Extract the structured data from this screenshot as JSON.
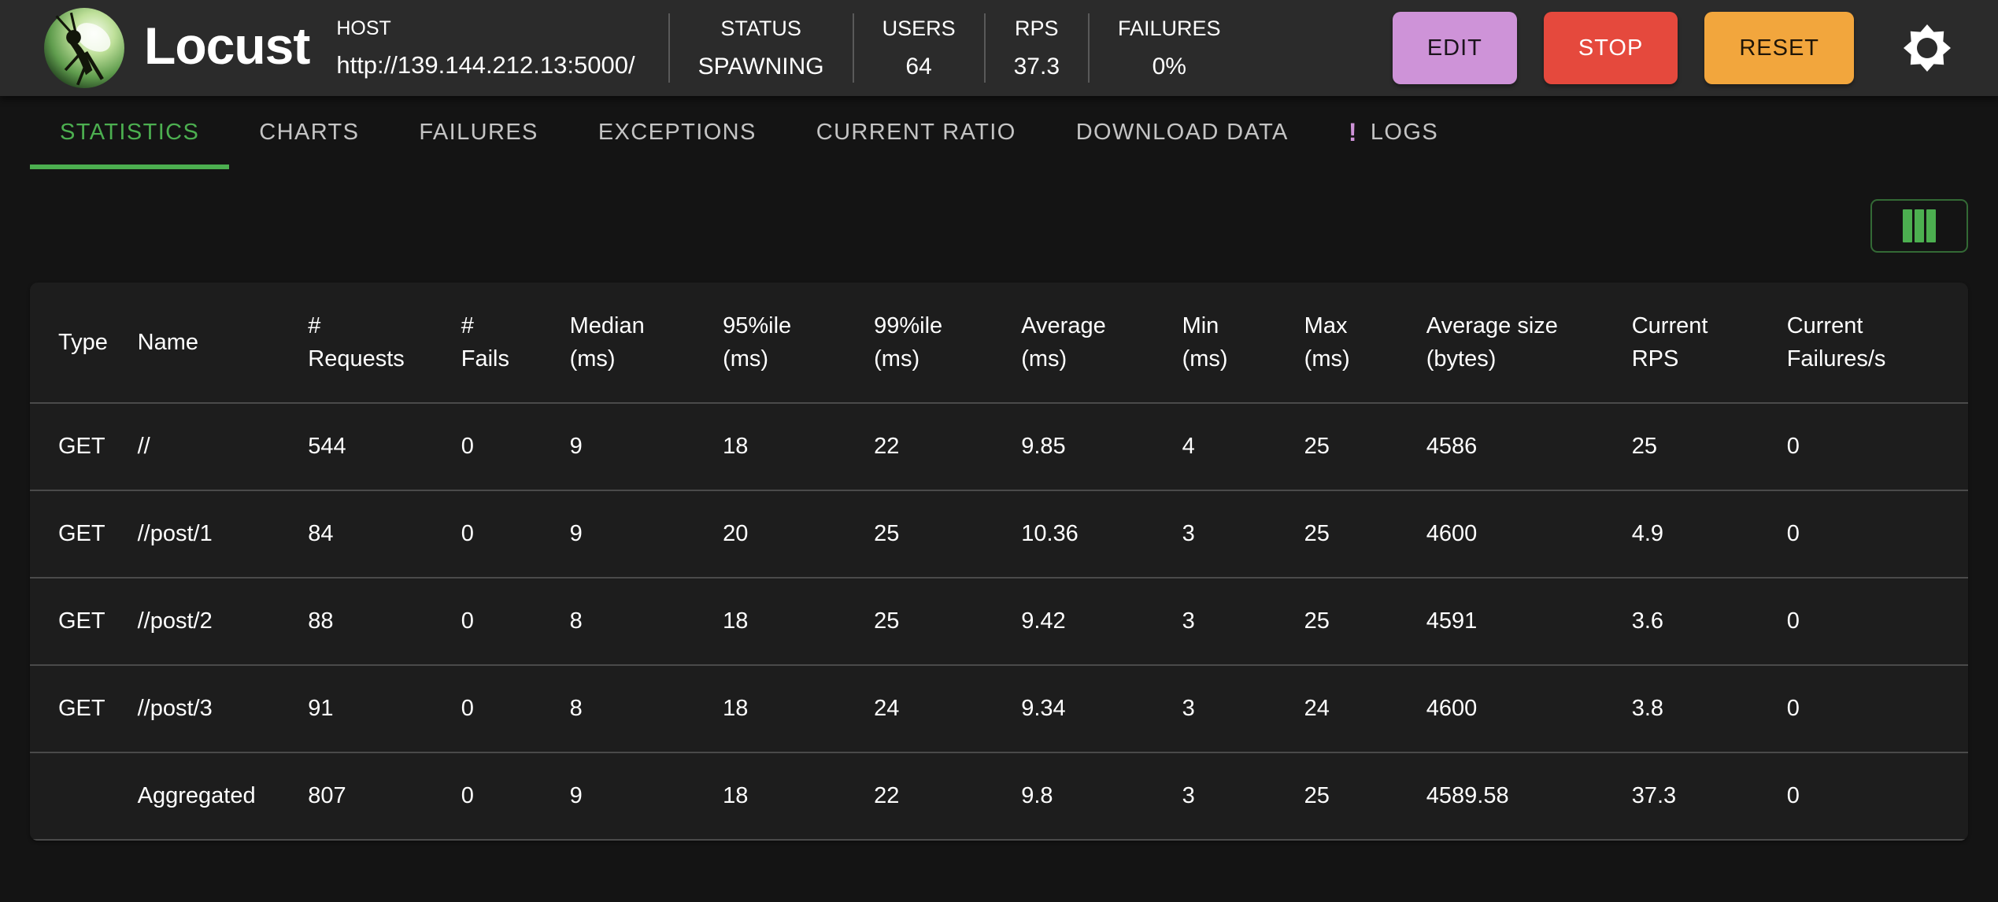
{
  "header": {
    "app_name": "Locust",
    "host_label": "HOST",
    "host_url": "http://139.144.212.13:5000/",
    "stats": [
      {
        "label": "STATUS",
        "value": "SPAWNING"
      },
      {
        "label": "USERS",
        "value": "64"
      },
      {
        "label": "RPS",
        "value": "37.3"
      },
      {
        "label": "FAILURES",
        "value": "0%"
      }
    ],
    "buttons": {
      "edit": "EDIT",
      "stop": "STOP",
      "reset": "RESET"
    },
    "icons": {
      "logo": "locust-logo",
      "settings": "gear-icon"
    }
  },
  "tabs": [
    {
      "label": "STATISTICS",
      "active": true
    },
    {
      "label": "CHARTS",
      "active": false
    },
    {
      "label": "FAILURES",
      "active": false
    },
    {
      "label": "EXCEPTIONS",
      "active": false
    },
    {
      "label": "CURRENT RATIO",
      "active": false
    },
    {
      "label": "DOWNLOAD DATA",
      "active": false
    },
    {
      "label": "LOGS",
      "active": false,
      "badge": "!"
    }
  ],
  "toolbar": {
    "icons": {
      "column_selector": "view-columns-icon"
    }
  },
  "table": {
    "columns": [
      [
        "Type"
      ],
      [
        "Name"
      ],
      [
        "#",
        "Requests"
      ],
      [
        "#",
        "Fails"
      ],
      [
        "Median",
        "(ms)"
      ],
      [
        "95%ile",
        "(ms)"
      ],
      [
        "99%ile",
        "(ms)"
      ],
      [
        "Average",
        "(ms)"
      ],
      [
        "Min",
        "(ms)"
      ],
      [
        "Max",
        "(ms)"
      ],
      [
        "Average size",
        "(bytes)"
      ],
      [
        "Current",
        "RPS"
      ],
      [
        "Current",
        "Failures/s"
      ]
    ],
    "rows": [
      [
        "GET",
        "//",
        "544",
        "0",
        "9",
        "18",
        "22",
        "9.85",
        "4",
        "25",
        "4586",
        "25",
        "0"
      ],
      [
        "GET",
        "//post/1",
        "84",
        "0",
        "9",
        "20",
        "25",
        "10.36",
        "3",
        "25",
        "4600",
        "4.9",
        "0"
      ],
      [
        "GET",
        "//post/2",
        "88",
        "0",
        "8",
        "18",
        "25",
        "9.42",
        "3",
        "25",
        "4591",
        "3.6",
        "0"
      ],
      [
        "GET",
        "//post/3",
        "91",
        "0",
        "8",
        "18",
        "24",
        "9.34",
        "3",
        "24",
        "4600",
        "3.8",
        "0"
      ],
      [
        "",
        "Aggregated",
        "807",
        "0",
        "9",
        "18",
        "22",
        "9.8",
        "3",
        "25",
        "4589.58",
        "37.3",
        "0"
      ]
    ]
  },
  "colors": {
    "green": "#4caf50",
    "purple": "#ce93d8",
    "red": "#e5493d",
    "orange": "#f2a63d"
  }
}
